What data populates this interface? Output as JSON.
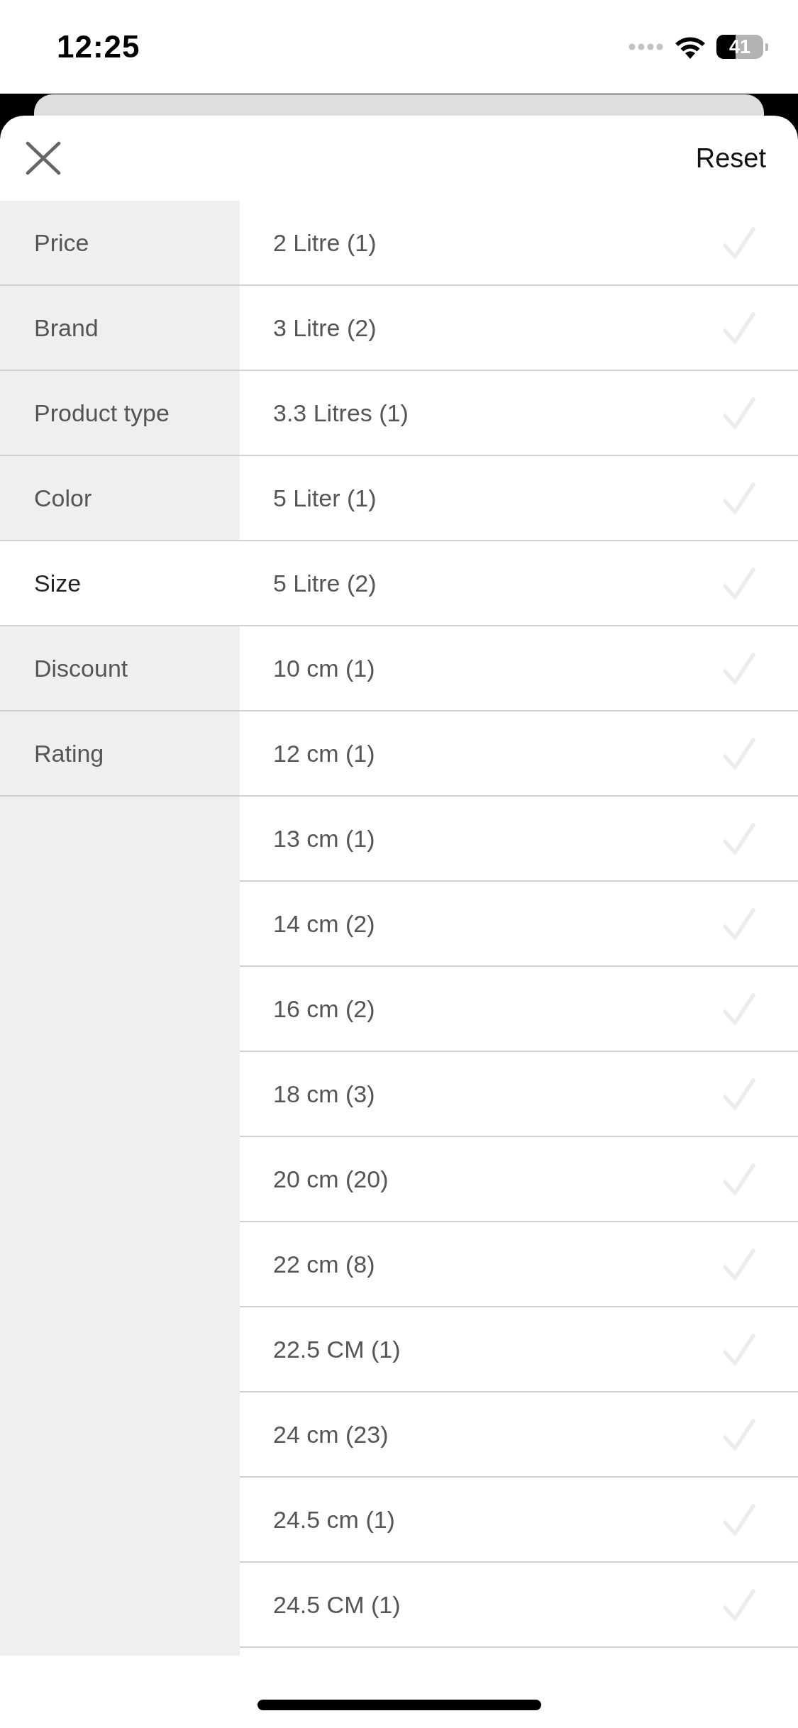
{
  "status_bar": {
    "time": "12:25",
    "battery": "41"
  },
  "header": {
    "reset": "Reset"
  },
  "categories": [
    {
      "label": "Price",
      "selected": false
    },
    {
      "label": "Brand",
      "selected": false
    },
    {
      "label": "Product type",
      "selected": false
    },
    {
      "label": "Color",
      "selected": false
    },
    {
      "label": "Size",
      "selected": true
    },
    {
      "label": "Discount",
      "selected": false
    },
    {
      "label": "Rating",
      "selected": false
    }
  ],
  "options": [
    {
      "label": "2 Litre (1)",
      "checked": false
    },
    {
      "label": "3 Litre (2)",
      "checked": false
    },
    {
      "label": "3.3 Litres (1)",
      "checked": false
    },
    {
      "label": "5 Liter (1)",
      "checked": false
    },
    {
      "label": "5 Litre (2)",
      "checked": false
    },
    {
      "label": "10 cm (1)",
      "checked": false
    },
    {
      "label": "12 cm (1)",
      "checked": false
    },
    {
      "label": "13 cm (1)",
      "checked": false
    },
    {
      "label": "14 cm (2)",
      "checked": false
    },
    {
      "label": "16 cm (2)",
      "checked": false
    },
    {
      "label": "18 cm (3)",
      "checked": false
    },
    {
      "label": "20 cm (20)",
      "checked": false
    },
    {
      "label": "22 cm (8)",
      "checked": false
    },
    {
      "label": "22.5 CM (1)",
      "checked": false
    },
    {
      "label": "24 cm (23)",
      "checked": false
    },
    {
      "label": "24.5 cm (1)",
      "checked": false
    },
    {
      "label": "24.5 CM (1)",
      "checked": false
    }
  ]
}
